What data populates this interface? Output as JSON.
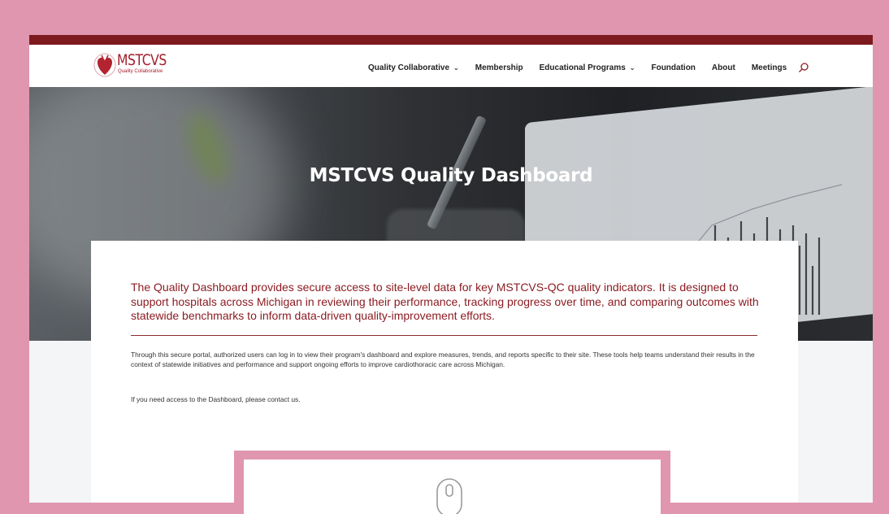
{
  "header": {
    "logo_text": "MSTCVS",
    "logo_subtitle": "Quality Collaborative",
    "nav": [
      {
        "label": "Quality Collaborative",
        "has_dropdown": true
      },
      {
        "label": "Membership",
        "has_dropdown": false
      },
      {
        "label": "Educational Programs",
        "has_dropdown": true
      },
      {
        "label": "Foundation",
        "has_dropdown": false
      },
      {
        "label": "About",
        "has_dropdown": false
      },
      {
        "label": "Meetings",
        "has_dropdown": false
      }
    ],
    "search_icon": "search-icon"
  },
  "hero": {
    "title": "MSTCVS Quality Dashboard"
  },
  "content": {
    "lead": "The Quality Dashboard provides secure access to site-level data for key MSTCVS-QC quality indicators. It is designed to support hospitals across Michigan in reviewing their performance, tracking progress over time, and comparing outcomes with statewide benchmarks to inform data-driven quality-improvement efforts.",
    "body": "Through this secure portal, authorized users can log in to view their program's dashboard and explore measures, trends, and reports specific to their site. These tools help teams understand their results in the context of statewide initiatives and performance and support ongoing efforts to improve cardiothoracic care across Michigan.",
    "contact": "If you need access to the Dashboard, please contact us."
  },
  "overlay": {
    "icon": "mouse-icon"
  },
  "colors": {
    "brand": "#a41e2a",
    "topbar": "#7d1a1f",
    "frame_bg": "#e096ae",
    "lead_text": "#8c1c22"
  }
}
